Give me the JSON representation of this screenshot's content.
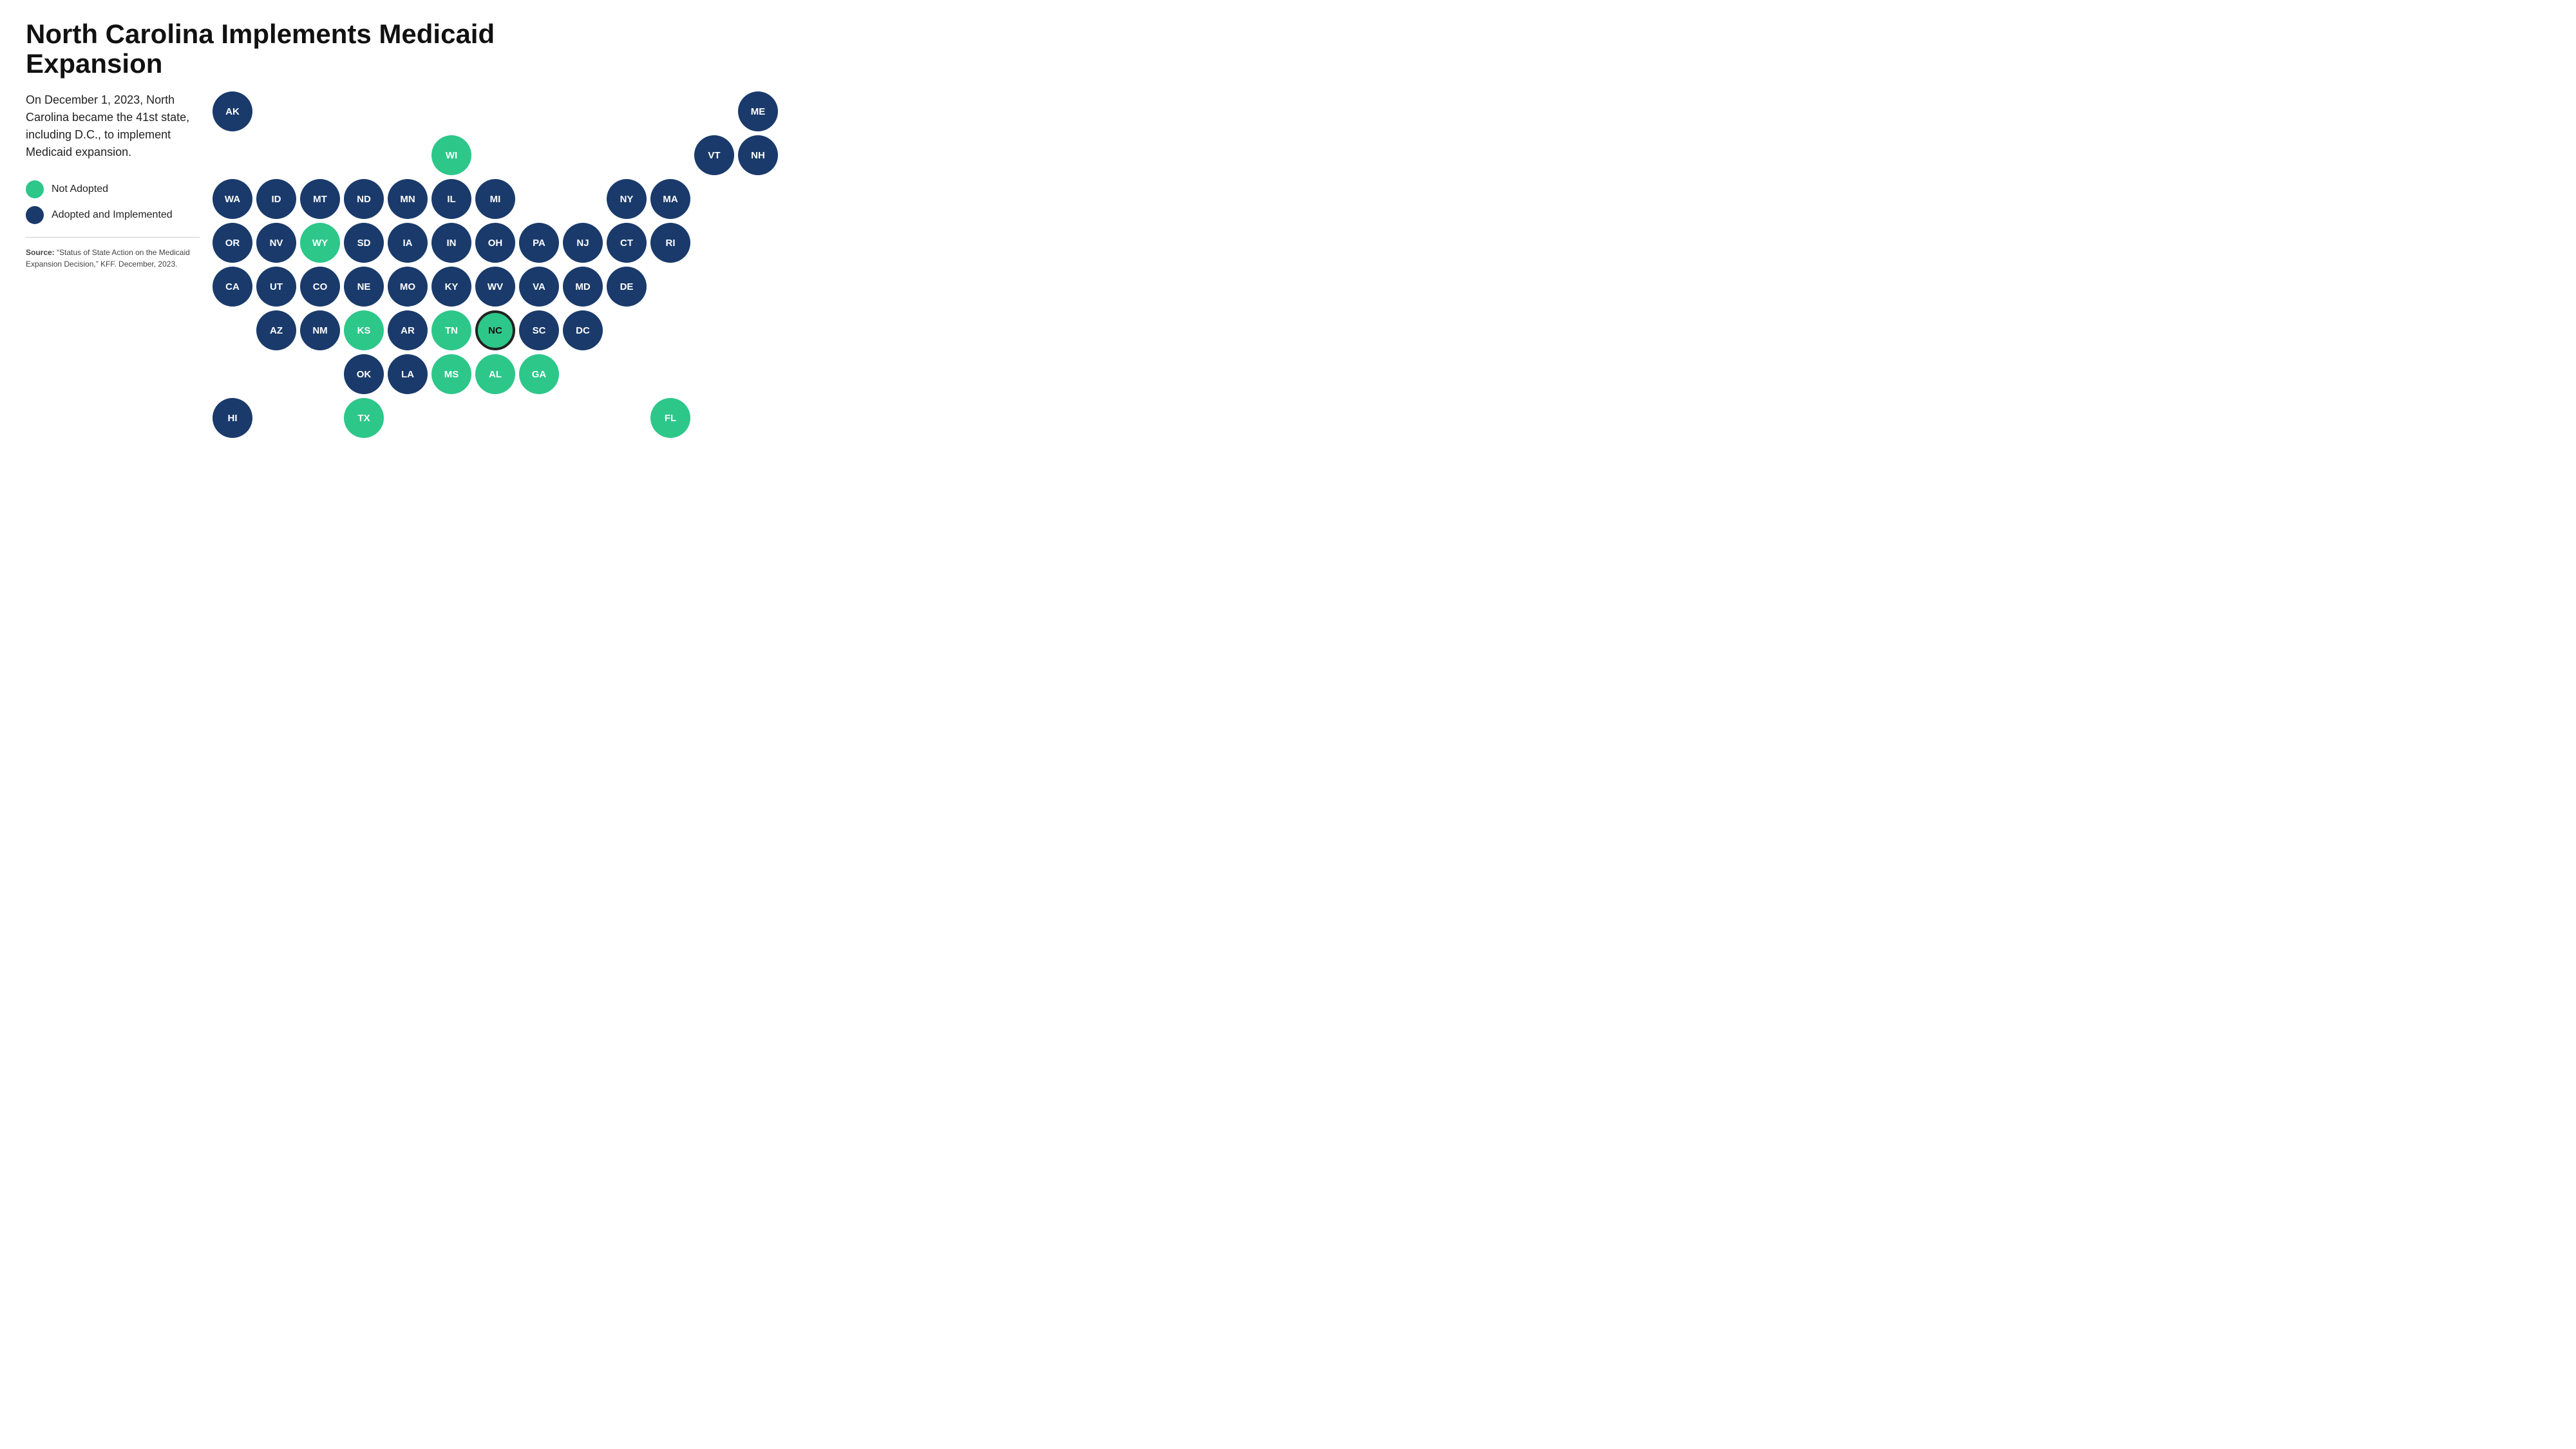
{
  "title": "North Carolina Implements Medicaid Expansion",
  "description": "On December 1, 2023, North Carolina became the 41st state, including D.C., to implement Medicaid expansion.",
  "legend": {
    "not_adopted_label": "Not Adopted",
    "adopted_label": "Adopted and Implemented"
  },
  "source_label": "Source:",
  "source_text": "“Status of State Action on the Medicaid Expansion Decision,” KFF. December, 2023.",
  "colors": {
    "adopted": "#1a3a6b",
    "not_adopted": "#2dc78a",
    "nc_border": "#222222"
  },
  "rows": [
    {
      "offset": 0,
      "states": [
        {
          "abbr": "AK",
          "status": "adopted"
        },
        {
          "abbr": "",
          "status": "spacer"
        },
        {
          "abbr": "",
          "status": "spacer"
        },
        {
          "abbr": "",
          "status": "spacer"
        },
        {
          "abbr": "",
          "status": "spacer"
        },
        {
          "abbr": "",
          "status": "spacer"
        },
        {
          "abbr": "",
          "status": "spacer"
        },
        {
          "abbr": "",
          "status": "spacer"
        },
        {
          "abbr": "",
          "status": "spacer"
        },
        {
          "abbr": "",
          "status": "spacer"
        },
        {
          "abbr": "",
          "status": "spacer"
        },
        {
          "abbr": "",
          "status": "spacer"
        },
        {
          "abbr": "ME",
          "status": "adopted"
        }
      ]
    },
    {
      "offset": 0,
      "states": [
        {
          "abbr": "",
          "status": "spacer"
        },
        {
          "abbr": "",
          "status": "spacer"
        },
        {
          "abbr": "",
          "status": "spacer"
        },
        {
          "abbr": "",
          "status": "spacer"
        },
        {
          "abbr": "",
          "status": "spacer"
        },
        {
          "abbr": "WI",
          "status": "not-adopted"
        },
        {
          "abbr": "",
          "status": "spacer"
        },
        {
          "abbr": "",
          "status": "spacer"
        },
        {
          "abbr": "",
          "status": "spacer"
        },
        {
          "abbr": "",
          "status": "spacer"
        },
        {
          "abbr": "",
          "status": "spacer"
        },
        {
          "abbr": "VT",
          "status": "adopted"
        },
        {
          "abbr": "NH",
          "status": "adopted"
        }
      ]
    },
    {
      "offset": 0,
      "states": [
        {
          "abbr": "WA",
          "status": "adopted"
        },
        {
          "abbr": "ID",
          "status": "adopted"
        },
        {
          "abbr": "MT",
          "status": "adopted"
        },
        {
          "abbr": "ND",
          "status": "adopted"
        },
        {
          "abbr": "MN",
          "status": "adopted"
        },
        {
          "abbr": "IL",
          "status": "adopted"
        },
        {
          "abbr": "MI",
          "status": "adopted"
        },
        {
          "abbr": "",
          "status": "spacer"
        },
        {
          "abbr": "",
          "status": "spacer"
        },
        {
          "abbr": "NY",
          "status": "adopted"
        },
        {
          "abbr": "MA",
          "status": "adopted"
        },
        {
          "abbr": "",
          "status": "spacer"
        },
        {
          "abbr": "",
          "status": "spacer"
        }
      ]
    },
    {
      "offset": 0,
      "states": [
        {
          "abbr": "OR",
          "status": "adopted"
        },
        {
          "abbr": "NV",
          "status": "adopted"
        },
        {
          "abbr": "WY",
          "status": "not-adopted"
        },
        {
          "abbr": "SD",
          "status": "adopted"
        },
        {
          "abbr": "IA",
          "status": "adopted"
        },
        {
          "abbr": "IN",
          "status": "adopted"
        },
        {
          "abbr": "OH",
          "status": "adopted"
        },
        {
          "abbr": "PA",
          "status": "adopted"
        },
        {
          "abbr": "NJ",
          "status": "adopted"
        },
        {
          "abbr": "CT",
          "status": "adopted"
        },
        {
          "abbr": "RI",
          "status": "adopted"
        },
        {
          "abbr": "",
          "status": "spacer"
        },
        {
          "abbr": "",
          "status": "spacer"
        }
      ]
    },
    {
      "offset": 0,
      "states": [
        {
          "abbr": "CA",
          "status": "adopted"
        },
        {
          "abbr": "UT",
          "status": "adopted"
        },
        {
          "abbr": "CO",
          "status": "adopted"
        },
        {
          "abbr": "NE",
          "status": "adopted"
        },
        {
          "abbr": "MO",
          "status": "adopted"
        },
        {
          "abbr": "KY",
          "status": "adopted"
        },
        {
          "abbr": "WV",
          "status": "adopted"
        },
        {
          "abbr": "VA",
          "status": "adopted"
        },
        {
          "abbr": "MD",
          "status": "adopted"
        },
        {
          "abbr": "DE",
          "status": "adopted"
        },
        {
          "abbr": "",
          "status": "spacer"
        },
        {
          "abbr": "",
          "status": "spacer"
        },
        {
          "abbr": "",
          "status": "spacer"
        }
      ]
    },
    {
      "offset": 1,
      "states": [
        {
          "abbr": "",
          "status": "spacer"
        },
        {
          "abbr": "AZ",
          "status": "adopted"
        },
        {
          "abbr": "NM",
          "status": "adopted"
        },
        {
          "abbr": "KS",
          "status": "not-adopted"
        },
        {
          "abbr": "AR",
          "status": "adopted"
        },
        {
          "abbr": "TN",
          "status": "not-adopted"
        },
        {
          "abbr": "NC",
          "status": "nc"
        },
        {
          "abbr": "SC",
          "status": "adopted"
        },
        {
          "abbr": "DC",
          "status": "adopted"
        },
        {
          "abbr": "",
          "status": "spacer"
        },
        {
          "abbr": "",
          "status": "spacer"
        },
        {
          "abbr": "",
          "status": "spacer"
        },
        {
          "abbr": "",
          "status": "spacer"
        }
      ]
    },
    {
      "offset": 2,
      "states": [
        {
          "abbr": "",
          "status": "spacer"
        },
        {
          "abbr": "",
          "status": "spacer"
        },
        {
          "abbr": "",
          "status": "spacer"
        },
        {
          "abbr": "OK",
          "status": "adopted"
        },
        {
          "abbr": "LA",
          "status": "adopted"
        },
        {
          "abbr": "MS",
          "status": "not-adopted"
        },
        {
          "abbr": "AL",
          "status": "not-adopted"
        },
        {
          "abbr": "GA",
          "status": "not-adopted"
        },
        {
          "abbr": "",
          "status": "spacer"
        },
        {
          "abbr": "",
          "status": "spacer"
        },
        {
          "abbr": "",
          "status": "spacer"
        },
        {
          "abbr": "",
          "status": "spacer"
        },
        {
          "abbr": "",
          "status": "spacer"
        }
      ]
    },
    {
      "offset": 0,
      "states": [
        {
          "abbr": "HI",
          "status": "adopted"
        },
        {
          "abbr": "",
          "status": "spacer"
        },
        {
          "abbr": "",
          "status": "spacer"
        },
        {
          "abbr": "TX",
          "status": "not-adopted"
        },
        {
          "abbr": "",
          "status": "spacer"
        },
        {
          "abbr": "",
          "status": "spacer"
        },
        {
          "abbr": "",
          "status": "spacer"
        },
        {
          "abbr": "",
          "status": "spacer"
        },
        {
          "abbr": "",
          "status": "spacer"
        },
        {
          "abbr": "",
          "status": "spacer"
        },
        {
          "abbr": "FL",
          "status": "not-adopted"
        },
        {
          "abbr": "",
          "status": "spacer"
        },
        {
          "abbr": "",
          "status": "spacer"
        }
      ]
    }
  ]
}
